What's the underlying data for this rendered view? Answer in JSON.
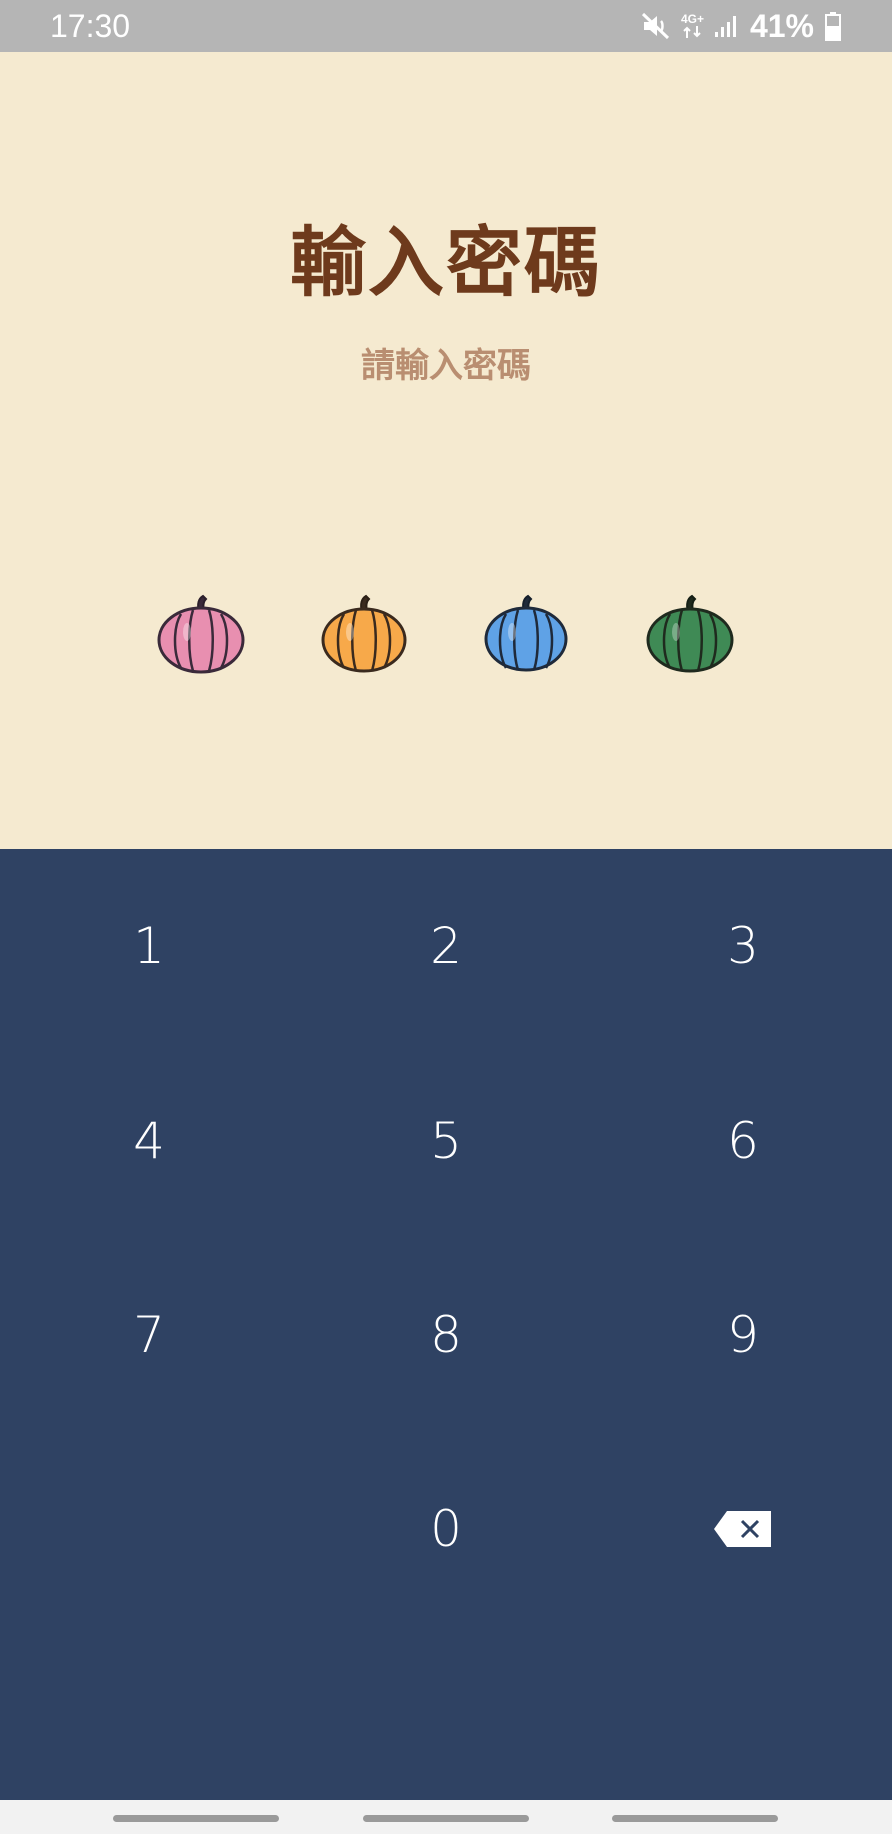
{
  "status_bar": {
    "time": "17:30",
    "network": "4G+",
    "battery": "41%",
    "icons": [
      "mute-icon",
      "network-icon",
      "signal-icon",
      "battery-icon"
    ]
  },
  "header": {
    "title": "輸入密碼",
    "subtitle": "請輸入密碼"
  },
  "pin_indicators": [
    {
      "name": "pumpkin-pink-icon",
      "color": "#e88fb0"
    },
    {
      "name": "pumpkin-orange-icon",
      "color": "#f7a94a"
    },
    {
      "name": "pumpkin-blue-icon",
      "color": "#5fa2e6"
    },
    {
      "name": "pumpkin-green-icon",
      "color": "#3f8a55"
    }
  ],
  "keypad": {
    "keys": [
      "1",
      "2",
      "3",
      "4",
      "5",
      "6",
      "7",
      "8",
      "9",
      "",
      "0",
      "backspace"
    ],
    "backspace_icon": "backspace-icon"
  },
  "colors": {
    "background": "#f5ead0",
    "title": "#6e3a1c",
    "subtitle": "#b98e71",
    "keypad_bg": "#2f4263",
    "key_text": "#ffffff"
  }
}
